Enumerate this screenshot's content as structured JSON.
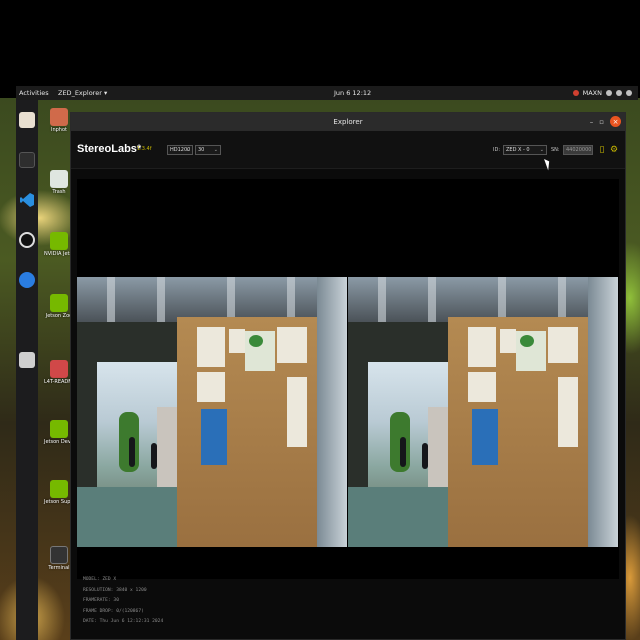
{
  "topbar": {
    "activities": "Activities",
    "app_menu": "ZED_Explorer ▾",
    "clock": "Jun 6  12:12",
    "maxn": "MAXN"
  },
  "desktop_icons": [
    {
      "label": "Inphot",
      "icon": "folder-icon"
    },
    {
      "label": "Trash",
      "icon": "trash-icon"
    },
    {
      "label": "NVIDIA Jetson Community",
      "icon": "nvidia-icon"
    },
    {
      "label": "Jetson Zoo",
      "icon": "nvidia-icon"
    },
    {
      "label": "L4T-README",
      "icon": "folder-icon"
    },
    {
      "label": "Jetson Developer Z",
      "icon": "nvidia-icon"
    },
    {
      "label": "Jetson Support Forums",
      "icon": "nvidia-icon"
    },
    {
      "label": "Terminal",
      "icon": "terminal-icon"
    }
  ],
  "window": {
    "title": "Explorer",
    "brand": "StereoLabs*",
    "version": "1.3.4f",
    "resolution_select": "HD1200",
    "fps_select": "30",
    "id_label": "ID:",
    "id_select": "ZED X - 0",
    "sn_label": "SN:",
    "sn_value": "44020000"
  },
  "info": {
    "model": "MODEL: ZED X",
    "resolution": "RESOLUTION: 3840 x 1200",
    "framerate": "FRAMERATE: 30",
    "frame_drop": "FRAME DROP: 0/(120867)",
    "date": "DATE: Thu Jun 6 12:12:31 2024"
  },
  "colors": {
    "accent": "#c8b800",
    "ubuntu_orange": "#e95420",
    "window_bg": "#0b0b0b"
  }
}
